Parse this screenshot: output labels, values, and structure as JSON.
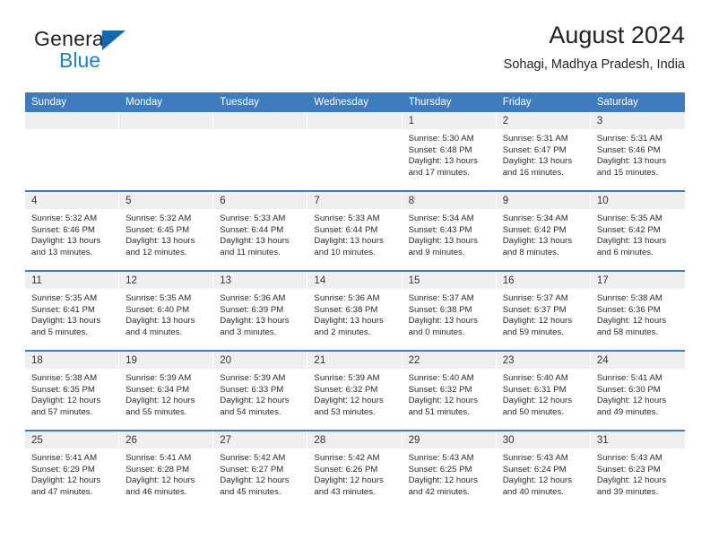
{
  "brand": {
    "name_primary": "General",
    "name_secondary": "Blue",
    "triangle_color": "#1667b1",
    "secondary_color": "#1b7fd4"
  },
  "header": {
    "title": "August 2024",
    "subtitle": "Sohagi, Madhya Pradesh, India",
    "accent_color": "#3c7cbf",
    "daynum_band_color": "#efefef"
  },
  "weekday_headers": [
    "Sunday",
    "Monday",
    "Tuesday",
    "Wednesday",
    "Thursday",
    "Friday",
    "Saturday"
  ],
  "labels": {
    "sunrise_prefix": "Sunrise:",
    "sunset_prefix": "Sunset:",
    "daylight_prefix": "Daylight:"
  },
  "weeks": [
    [
      {
        "empty": true
      },
      {
        "empty": true
      },
      {
        "empty": true
      },
      {
        "empty": true
      },
      {
        "day": "1",
        "sunrise": "Sunrise: 5:30 AM",
        "sunset": "Sunset: 6:48 PM",
        "daylight_line1": "Daylight: 13 hours",
        "daylight_line2": "and 17 minutes."
      },
      {
        "day": "2",
        "sunrise": "Sunrise: 5:31 AM",
        "sunset": "Sunset: 6:47 PM",
        "daylight_line1": "Daylight: 13 hours",
        "daylight_line2": "and 16 minutes."
      },
      {
        "day": "3",
        "sunrise": "Sunrise: 5:31 AM",
        "sunset": "Sunset: 6:46 PM",
        "daylight_line1": "Daylight: 13 hours",
        "daylight_line2": "and 15 minutes."
      }
    ],
    [
      {
        "day": "4",
        "sunrise": "Sunrise: 5:32 AM",
        "sunset": "Sunset: 6:46 PM",
        "daylight_line1": "Daylight: 13 hours",
        "daylight_line2": "and 13 minutes."
      },
      {
        "day": "5",
        "sunrise": "Sunrise: 5:32 AM",
        "sunset": "Sunset: 6:45 PM",
        "daylight_line1": "Daylight: 13 hours",
        "daylight_line2": "and 12 minutes."
      },
      {
        "day": "6",
        "sunrise": "Sunrise: 5:33 AM",
        "sunset": "Sunset: 6:44 PM",
        "daylight_line1": "Daylight: 13 hours",
        "daylight_line2": "and 11 minutes."
      },
      {
        "day": "7",
        "sunrise": "Sunrise: 5:33 AM",
        "sunset": "Sunset: 6:44 PM",
        "daylight_line1": "Daylight: 13 hours",
        "daylight_line2": "and 10 minutes."
      },
      {
        "day": "8",
        "sunrise": "Sunrise: 5:34 AM",
        "sunset": "Sunset: 6:43 PM",
        "daylight_line1": "Daylight: 13 hours",
        "daylight_line2": "and 9 minutes."
      },
      {
        "day": "9",
        "sunrise": "Sunrise: 5:34 AM",
        "sunset": "Sunset: 6:42 PM",
        "daylight_line1": "Daylight: 13 hours",
        "daylight_line2": "and 8 minutes."
      },
      {
        "day": "10",
        "sunrise": "Sunrise: 5:35 AM",
        "sunset": "Sunset: 6:42 PM",
        "daylight_line1": "Daylight: 13 hours",
        "daylight_line2": "and 6 minutes."
      }
    ],
    [
      {
        "day": "11",
        "sunrise": "Sunrise: 5:35 AM",
        "sunset": "Sunset: 6:41 PM",
        "daylight_line1": "Daylight: 13 hours",
        "daylight_line2": "and 5 minutes."
      },
      {
        "day": "12",
        "sunrise": "Sunrise: 5:35 AM",
        "sunset": "Sunset: 6:40 PM",
        "daylight_line1": "Daylight: 13 hours",
        "daylight_line2": "and 4 minutes."
      },
      {
        "day": "13",
        "sunrise": "Sunrise: 5:36 AM",
        "sunset": "Sunset: 6:39 PM",
        "daylight_line1": "Daylight: 13 hours",
        "daylight_line2": "and 3 minutes."
      },
      {
        "day": "14",
        "sunrise": "Sunrise: 5:36 AM",
        "sunset": "Sunset: 6:38 PM",
        "daylight_line1": "Daylight: 13 hours",
        "daylight_line2": "and 2 minutes."
      },
      {
        "day": "15",
        "sunrise": "Sunrise: 5:37 AM",
        "sunset": "Sunset: 6:38 PM",
        "daylight_line1": "Daylight: 13 hours",
        "daylight_line2": "and 0 minutes."
      },
      {
        "day": "16",
        "sunrise": "Sunrise: 5:37 AM",
        "sunset": "Sunset: 6:37 PM",
        "daylight_line1": "Daylight: 12 hours",
        "daylight_line2": "and 59 minutes."
      },
      {
        "day": "17",
        "sunrise": "Sunrise: 5:38 AM",
        "sunset": "Sunset: 6:36 PM",
        "daylight_line1": "Daylight: 12 hours",
        "daylight_line2": "and 58 minutes."
      }
    ],
    [
      {
        "day": "18",
        "sunrise": "Sunrise: 5:38 AM",
        "sunset": "Sunset: 6:35 PM",
        "daylight_line1": "Daylight: 12 hours",
        "daylight_line2": "and 57 minutes."
      },
      {
        "day": "19",
        "sunrise": "Sunrise: 5:39 AM",
        "sunset": "Sunset: 6:34 PM",
        "daylight_line1": "Daylight: 12 hours",
        "daylight_line2": "and 55 minutes."
      },
      {
        "day": "20",
        "sunrise": "Sunrise: 5:39 AM",
        "sunset": "Sunset: 6:33 PM",
        "daylight_line1": "Daylight: 12 hours",
        "daylight_line2": "and 54 minutes."
      },
      {
        "day": "21",
        "sunrise": "Sunrise: 5:39 AM",
        "sunset": "Sunset: 6:32 PM",
        "daylight_line1": "Daylight: 12 hours",
        "daylight_line2": "and 53 minutes."
      },
      {
        "day": "22",
        "sunrise": "Sunrise: 5:40 AM",
        "sunset": "Sunset: 6:32 PM",
        "daylight_line1": "Daylight: 12 hours",
        "daylight_line2": "and 51 minutes."
      },
      {
        "day": "23",
        "sunrise": "Sunrise: 5:40 AM",
        "sunset": "Sunset: 6:31 PM",
        "daylight_line1": "Daylight: 12 hours",
        "daylight_line2": "and 50 minutes."
      },
      {
        "day": "24",
        "sunrise": "Sunrise: 5:41 AM",
        "sunset": "Sunset: 6:30 PM",
        "daylight_line1": "Daylight: 12 hours",
        "daylight_line2": "and 49 minutes."
      }
    ],
    [
      {
        "day": "25",
        "sunrise": "Sunrise: 5:41 AM",
        "sunset": "Sunset: 6:29 PM",
        "daylight_line1": "Daylight: 12 hours",
        "daylight_line2": "and 47 minutes."
      },
      {
        "day": "26",
        "sunrise": "Sunrise: 5:41 AM",
        "sunset": "Sunset: 6:28 PM",
        "daylight_line1": "Daylight: 12 hours",
        "daylight_line2": "and 46 minutes."
      },
      {
        "day": "27",
        "sunrise": "Sunrise: 5:42 AM",
        "sunset": "Sunset: 6:27 PM",
        "daylight_line1": "Daylight: 12 hours",
        "daylight_line2": "and 45 minutes."
      },
      {
        "day": "28",
        "sunrise": "Sunrise: 5:42 AM",
        "sunset": "Sunset: 6:26 PM",
        "daylight_line1": "Daylight: 12 hours",
        "daylight_line2": "and 43 minutes."
      },
      {
        "day": "29",
        "sunrise": "Sunrise: 5:43 AM",
        "sunset": "Sunset: 6:25 PM",
        "daylight_line1": "Daylight: 12 hours",
        "daylight_line2": "and 42 minutes."
      },
      {
        "day": "30",
        "sunrise": "Sunrise: 5:43 AM",
        "sunset": "Sunset: 6:24 PM",
        "daylight_line1": "Daylight: 12 hours",
        "daylight_line2": "and 40 minutes."
      },
      {
        "day": "31",
        "sunrise": "Sunrise: 5:43 AM",
        "sunset": "Sunset: 6:23 PM",
        "daylight_line1": "Daylight: 12 hours",
        "daylight_line2": "and 39 minutes."
      }
    ]
  ]
}
